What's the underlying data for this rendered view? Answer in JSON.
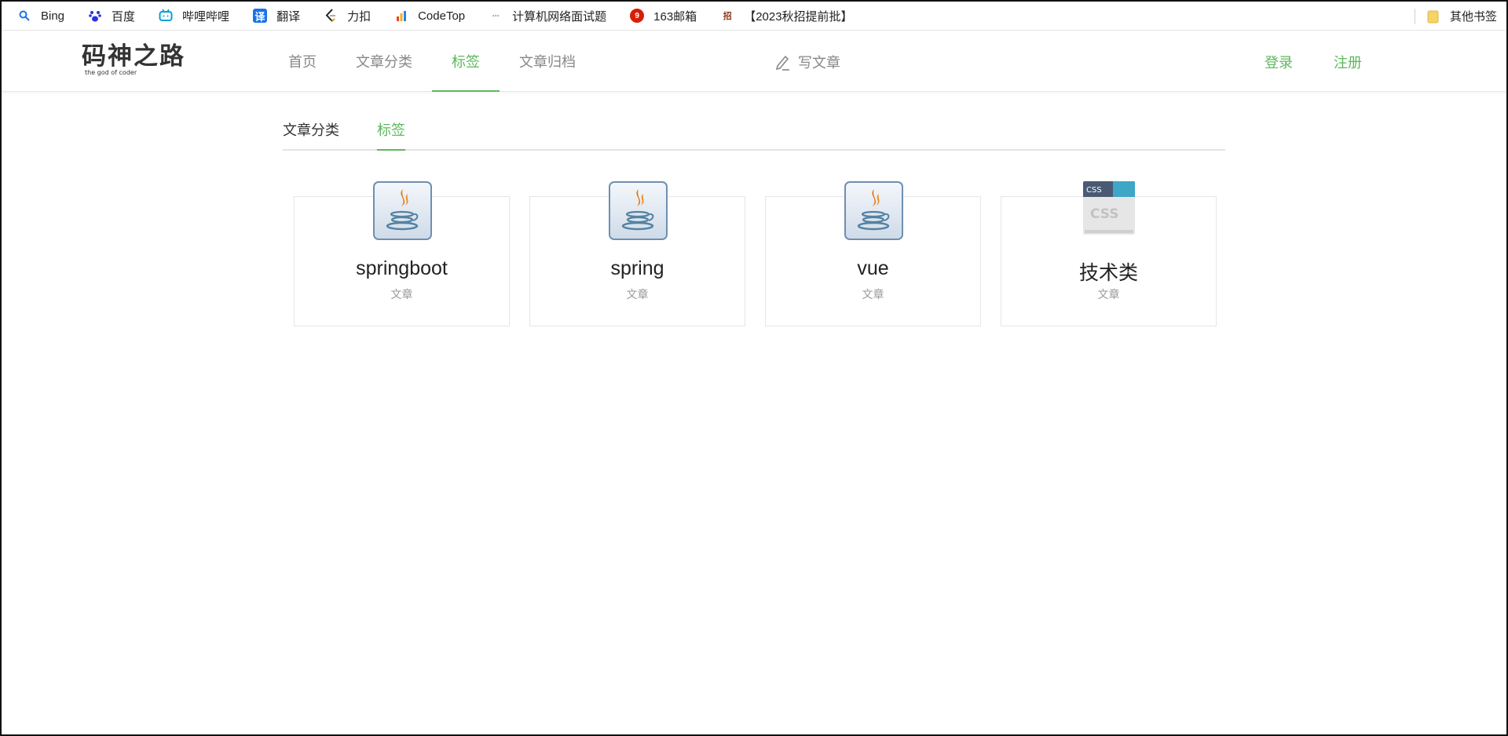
{
  "bookmarks": {
    "items": [
      {
        "label": "Bing",
        "icon": "search-icon",
        "color": "#1a73e8"
      },
      {
        "label": "百度",
        "icon": "paw-icon",
        "color": "#2932e1"
      },
      {
        "label": "哔哩哔哩",
        "icon": "tv-icon",
        "color": "#00a1d6"
      },
      {
        "label": "翻译",
        "icon": "translate-icon",
        "color": "#1a73e8"
      },
      {
        "label": "力扣",
        "icon": "leetcode-icon",
        "color": "#e6a020"
      },
      {
        "label": "CodeTop",
        "icon": "bar-chart-icon",
        "color": "#e64a19"
      },
      {
        "label": "计算机网络面试题",
        "icon": "dots-icon",
        "color": "#999999"
      },
      {
        "label": "163邮箱",
        "icon": "mail-163-icon",
        "color": "#d81e06"
      },
      {
        "label": "【2023秋招提前批】",
        "icon": "bookmark-site-icon",
        "color": "#8b3a1a"
      }
    ],
    "other": {
      "label": "其他书签",
      "icon": "folder-icon",
      "color": "#f6d365"
    }
  },
  "header": {
    "logo_text": "码神之路",
    "logo_sub": "the god of coder",
    "nav": [
      {
        "label": "首页",
        "active": false
      },
      {
        "label": "文章分类",
        "active": false
      },
      {
        "label": "标签",
        "active": true
      },
      {
        "label": "文章归档",
        "active": false
      }
    ],
    "write_label": "写文章",
    "login_label": "登录",
    "register_label": "注册"
  },
  "subtabs": [
    {
      "label": "文章分类",
      "active": false
    },
    {
      "label": "标签",
      "active": true
    }
  ],
  "tags": [
    {
      "name": "springboot",
      "sub": "文章",
      "icon": "java-icon"
    },
    {
      "name": "spring",
      "sub": "文章",
      "icon": "java-icon"
    },
    {
      "name": "vue",
      "sub": "文章",
      "icon": "java-icon"
    },
    {
      "name": "技术类",
      "sub": "文章",
      "icon": "css-icon"
    }
  ],
  "colors": {
    "accent": "#5cb85c",
    "muted": "#888888"
  }
}
